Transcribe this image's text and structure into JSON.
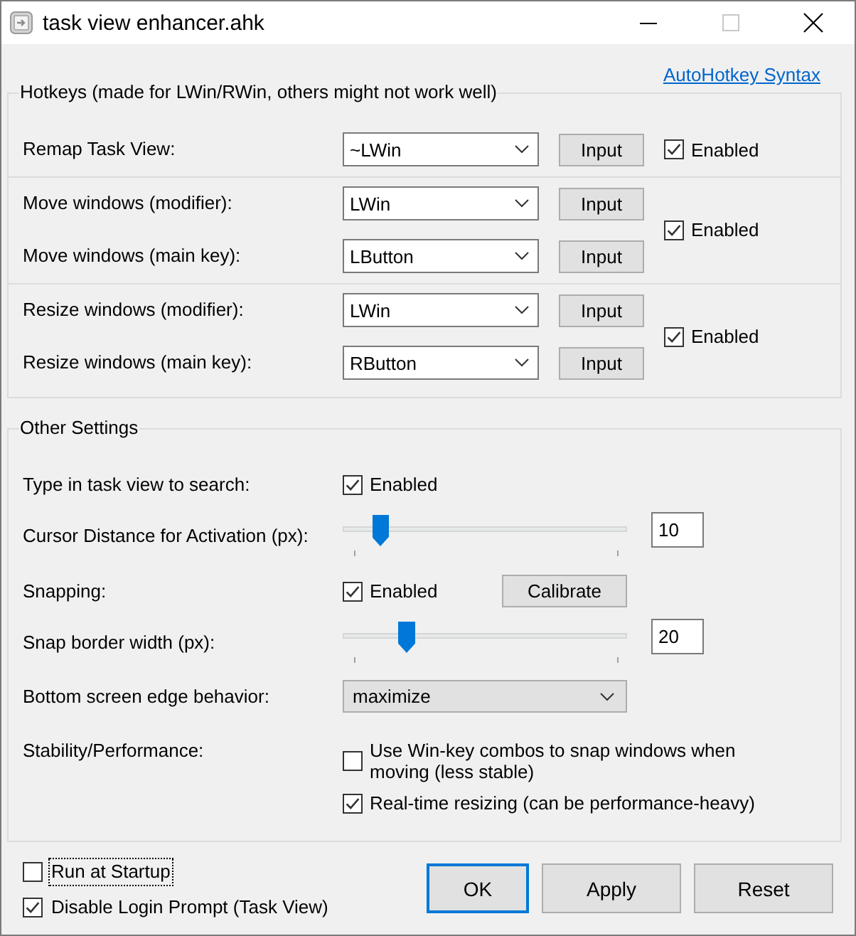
{
  "window": {
    "title": "task view enhancer.ahk",
    "controls": [
      {
        "kind": "minimize",
        "disabled": false
      },
      {
        "kind": "maximize",
        "disabled": true
      },
      {
        "kind": "close",
        "disabled": false
      }
    ]
  },
  "syntax_link": "AutoHotkey Syntax",
  "hotkeys": {
    "title": "Hotkeys (made for LWin/RWin, others might not work well)",
    "sections": [
      {
        "rows": [
          {
            "label": "Remap Task View:",
            "value": "~LWin",
            "button": "Input"
          }
        ],
        "checkbox": {
          "label": "Enabled",
          "checked": true
        }
      },
      {
        "rows": [
          {
            "label": "Move windows (modifier):",
            "value": "LWin",
            "button": "Input"
          },
          {
            "label": "Move windows (main key):",
            "value": "LButton",
            "button": "Input"
          }
        ],
        "checkbox": {
          "label": "Enabled",
          "checked": true
        }
      },
      {
        "rows": [
          {
            "label": "Resize windows (modifier):",
            "value": "LWin",
            "button": "Input"
          },
          {
            "label": "Resize windows (main key):",
            "value": "RButton",
            "button": "Input"
          }
        ],
        "checkbox": {
          "label": "Enabled",
          "checked": true
        }
      }
    ]
  },
  "other_settings": {
    "title": "Other Settings",
    "rows": [
      {
        "kind": "checkbox",
        "label": "Type in task view to search:",
        "checkbox": {
          "label": "Enabled",
          "checked": true
        }
      },
      {
        "kind": "slider",
        "label": "Cursor Distance for Activation (px):",
        "level": 0.1,
        "value": "10"
      },
      {
        "kind": "checkbox",
        "label": "Snapping:",
        "checkbox": {
          "label": "Enabled",
          "checked": true
        },
        "button": "Calibrate"
      },
      {
        "kind": "slider",
        "label": "Snap border width (px):",
        "level": 0.2,
        "value": "20"
      },
      {
        "kind": "dropdown",
        "label": "Bottom screen edge behavior:",
        "value": "maximize"
      },
      {
        "kind": "options",
        "label": "Stability/Performance:",
        "options": [
          {
            "label": "Use Win-key combos to snap windows when moving (less stable)",
            "checked": false
          },
          {
            "label": "Real-time resizing (can be performance-heavy)",
            "checked": true
          }
        ]
      }
    ]
  },
  "footer": {
    "checkboxes": [
      {
        "label": "Run at Startup",
        "checked": false,
        "focused": true
      },
      {
        "label": "Disable Login Prompt (Task View)",
        "checked": true,
        "focused": false
      }
    ],
    "buttons": [
      {
        "label": "OK",
        "default": true
      },
      {
        "label": "Apply",
        "default": false
      },
      {
        "label": "Reset",
        "default": false
      }
    ]
  }
}
